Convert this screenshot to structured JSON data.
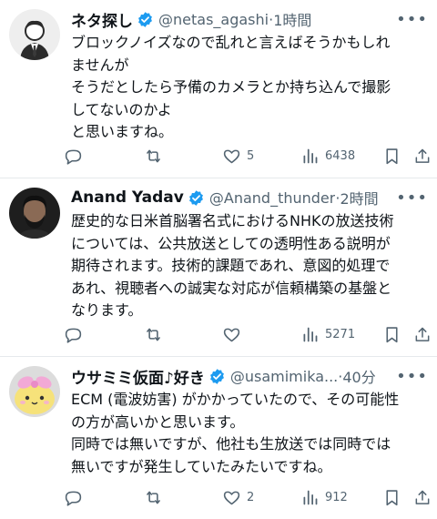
{
  "tweets": [
    {
      "name": "ネタ探し",
      "handle": "@netas_agashi",
      "separator": "·",
      "time": "1時間",
      "body": [
        "ブロックノイズなので乱れと言えばそうかもしれ",
        "ませんが",
        "そうだとしたら予備のカメラとか持ち込んで撮影",
        "してないのかよ",
        "と思いますね。"
      ],
      "replies": "",
      "retweets": "",
      "likes": "5",
      "views": "6438"
    },
    {
      "name": "Anand Yadav",
      "handle": "@Anand_thunder",
      "separator": "·",
      "time": "2時間",
      "body": [
        "歴史的な日米首脳署名式におけるNHKの放送技術",
        "については、公共放送としての透明性ある説明が",
        "期待されます。技術的課題であれ、意図的処理で",
        "あれ、視聴者への誠実な対応が信頼構築の基盤と",
        "なります。"
      ],
      "replies": "",
      "retweets": "",
      "likes": "",
      "views": "5271"
    },
    {
      "name": "ウサミミ仮面♪好き",
      "handle": "@usamimika...",
      "separator": "·",
      "time": "40分",
      "body": [
        "ECM (電波妨害) がかかっていたので、その可能性",
        "の方が高いかと思います。",
        "同時では無いですが、他社も生放送では同時では",
        "無いですが発生していたみたいですね。"
      ],
      "replies": "",
      "retweets": "",
      "likes": "2",
      "views": "912"
    }
  ],
  "icons": {
    "verified": "verified-badge-icon",
    "more": "more-options-icon",
    "reply": "reply-icon",
    "retweet": "retweet-icon",
    "like": "heart-icon",
    "views": "views-chart-icon",
    "bookmark": "bookmark-icon",
    "share": "share-icon"
  },
  "colors": {
    "verified": "#1d9bf0",
    "muted": "#536471",
    "text": "#0f1419"
  }
}
